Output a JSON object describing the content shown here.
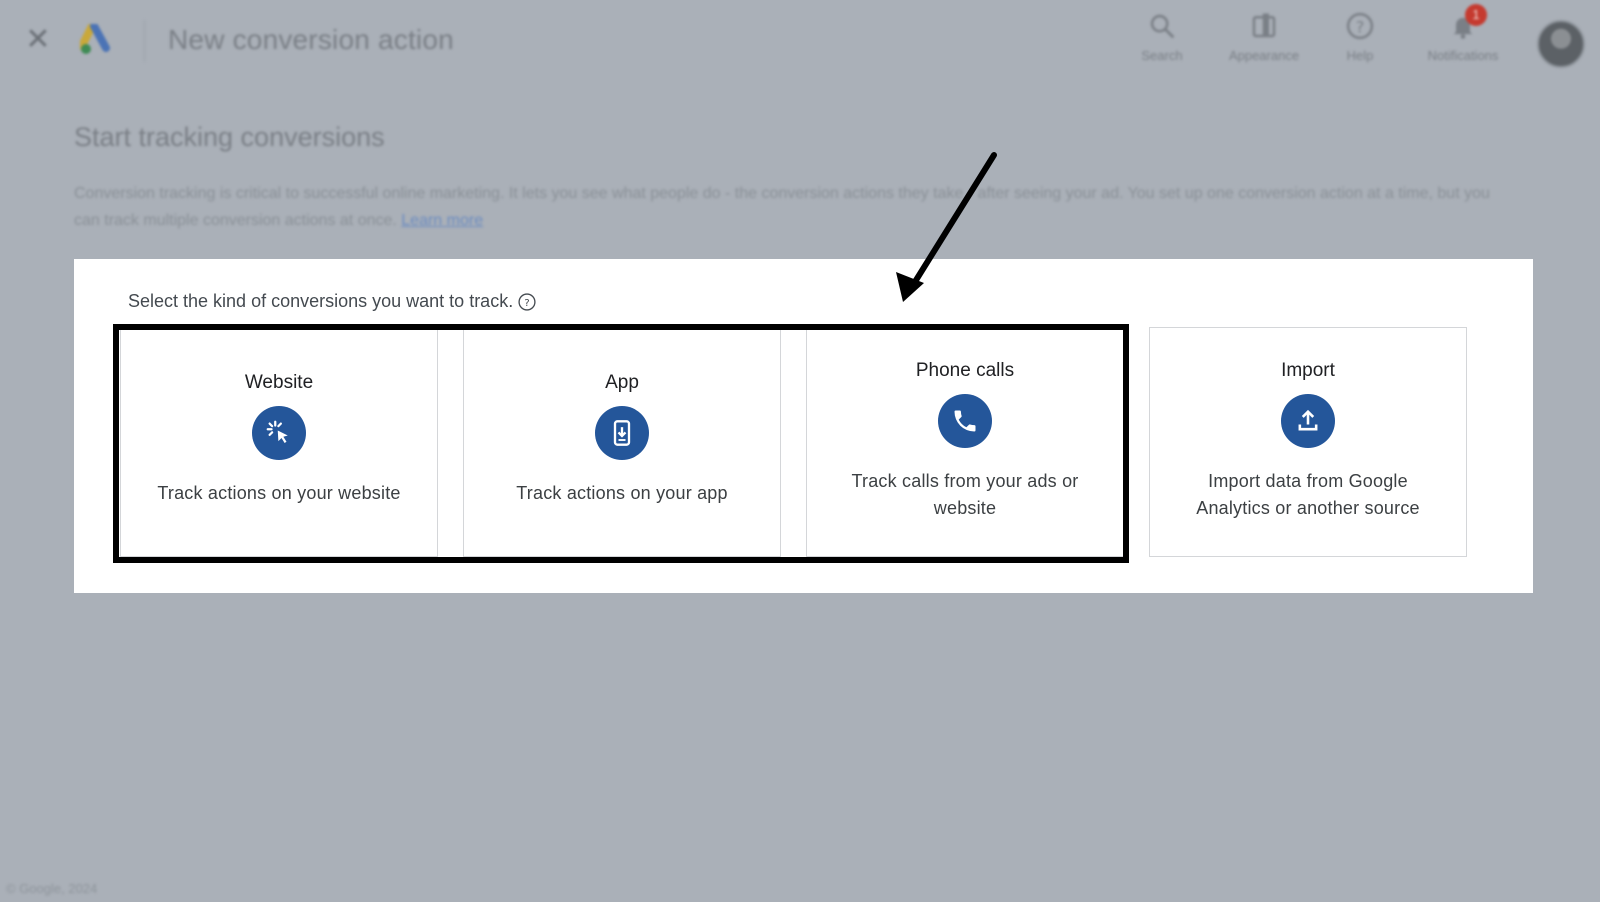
{
  "header": {
    "title": "New conversion action",
    "actions": [
      {
        "label": "Search",
        "icon": "search-icon"
      },
      {
        "label": "Appearance",
        "icon": "appearance-icon"
      },
      {
        "label": "Help",
        "icon": "help-icon"
      },
      {
        "label": "Notifications",
        "icon": "bell-icon",
        "badge": "1"
      }
    ]
  },
  "page": {
    "heading": "Start tracking conversions",
    "intro": "Conversion tracking is critical to successful online marketing. It lets you see what people do - the conversion actions they take - after seeing your ad. You set up one conversion action at a time, but you can track multiple conversion actions at once.",
    "learn_more": "Learn more"
  },
  "panel": {
    "prompt": "Select the kind of conversions you want to track.",
    "cards": [
      {
        "title": "Website",
        "description": "Track actions on your website",
        "icon": "cursor-click-icon"
      },
      {
        "title": "App",
        "description": "Track actions on your app",
        "icon": "phone-download-icon"
      },
      {
        "title": "Phone calls",
        "description": "Track calls from your ads or website",
        "icon": "phone-call-icon"
      },
      {
        "title": "Import",
        "description": "Import data from Google Analytics or another source",
        "icon": "upload-icon"
      }
    ]
  },
  "footer": {
    "copyright": "© Google, 2024"
  },
  "colors": {
    "accent_blue": "#24569a",
    "backdrop": "#aab0b8",
    "highlight": "#000000"
  }
}
